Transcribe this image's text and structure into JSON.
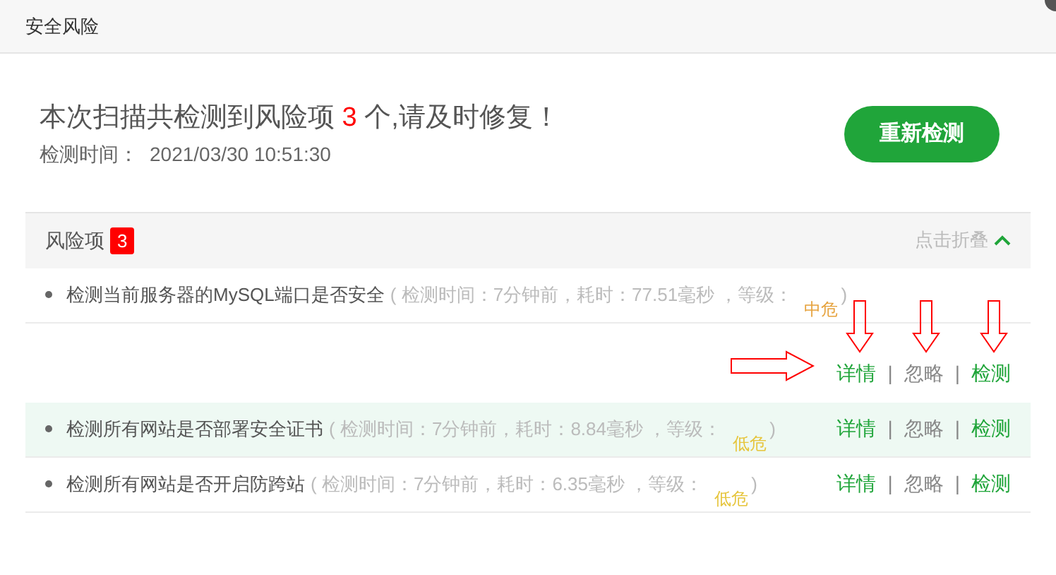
{
  "window": {
    "title": "安全风险"
  },
  "summary": {
    "prefix": "本次扫描共检测到风险项",
    "count": "3",
    "suffix": "个,请及时修复！",
    "time_label": "检测时间：",
    "time_value": "2021/03/30 10:51:30"
  },
  "rescan_button": "重新检测",
  "section": {
    "title": "风险项",
    "badge": "3",
    "collapse_link": "点击折叠",
    "expanded": true
  },
  "items": [
    {
      "name": "检测当前服务器的MySQL端口是否安全",
      "open": "(",
      "detail": "检测时间：7分钟前，耗时：77.51毫秒 ，等级：",
      "close": ")",
      "level": "中危",
      "color": "#e6a23c",
      "highlighted": false,
      "actions_wrapped": true,
      "separator": "|",
      "actions": [
        "详情",
        "忽略",
        "检测"
      ]
    },
    {
      "name": "检测所有网站是否部署安全证书",
      "open": "(",
      "detail": "检测时间：7分钟前，耗时：8.84毫秒 ，等级：",
      "close": ")",
      "level": "低危",
      "color": "#e6c53c",
      "highlighted": true,
      "actions_wrapped": false,
      "separator": "|",
      "actions": [
        "详情",
        "忽略",
        "检测"
      ]
    },
    {
      "name": "检测所有网站是否开启防跨站",
      "open": "(",
      "detail": "检测时间：7分钟前，耗时：6.35毫秒 ，等级：",
      "close": ")",
      "level": "低危",
      "color": "#e6c53c",
      "highlighted": false,
      "actions_wrapped": false,
      "separator": "|",
      "actions": [
        "详情",
        "忽略",
        "检测"
      ]
    }
  ]
}
